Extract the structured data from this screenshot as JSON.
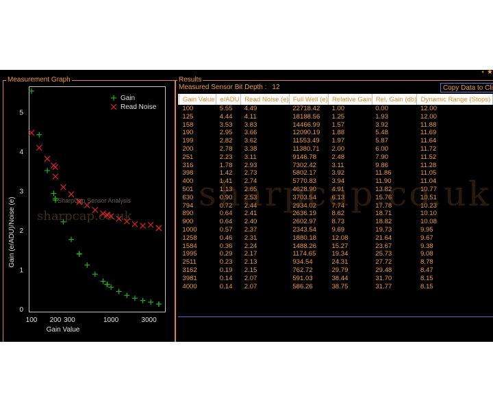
{
  "window": {
    "corner_glyphs": "⋆ ★"
  },
  "graph_panel": {
    "title": "Measurement Graph"
  },
  "results_panel": {
    "title": "Results",
    "bit_depth_label": "Measured Sensor Bit Depth :",
    "bit_depth_value": "12",
    "copy_button_label": "Copy Data to Clipboard"
  },
  "table": {
    "headers": [
      "Gain Value",
      "e/ADU",
      "Read Noise (e)",
      "Full Well (e)",
      "Relative Gain",
      "Rel. Gain (db)",
      "Dynamic Range (Stops)"
    ],
    "rows": [
      [
        "100",
        "5.55",
        "4.49",
        "22718.42",
        "1.00",
        "0.00",
        "12.00"
      ],
      [
        "125",
        "4.44",
        "4.11",
        "18188.56",
        "1.25",
        "1.93",
        "12.00"
      ],
      [
        "158",
        "3.53",
        "3.83",
        "14466.99",
        "1.57",
        "3.92",
        "11.88"
      ],
      [
        "190",
        "2.95",
        "3.66",
        "12090.19",
        "1.88",
        "5.48",
        "11.69"
      ],
      [
        "199",
        "2.82",
        "3.62",
        "11553.49",
        "1.97",
        "5.87",
        "11.64"
      ],
      [
        "200",
        "2.78",
        "3.38",
        "11380.71",
        "2.00",
        "6.00",
        "11.72"
      ],
      [
        "251",
        "2.23",
        "3.11",
        "9146.78",
        "2.48",
        "7.90",
        "11.52"
      ],
      [
        "316",
        "1.78",
        "2.93",
        "7302.42",
        "3.11",
        "9.86",
        "11.28"
      ],
      [
        "398",
        "1.42",
        "2.73",
        "5802.17",
        "3.92",
        "11.86",
        "11.05"
      ],
      [
        "400",
        "1.41",
        "2.74",
        "5770.83",
        "3.94",
        "11.90",
        "11.04"
      ],
      [
        "501",
        "1.13",
        "2.65",
        "4628.90",
        "4.91",
        "13.82",
        "10.77"
      ],
      [
        "630",
        "0.90",
        "2.53",
        "3703.54",
        "6.13",
        "15.76",
        "10.51"
      ],
      [
        "794",
        "0.72",
        "2.44",
        "2934.02",
        "7.74",
        "17.78",
        "10.23"
      ],
      [
        "890",
        "0.64",
        "2.41",
        "2636.19",
        "8.62",
        "18.71",
        "10.10"
      ],
      [
        "900",
        "0.64",
        "2.40",
        "2602.97",
        "8.73",
        "18.82",
        "10.08"
      ],
      [
        "1000",
        "0.57",
        "2.37",
        "2343.54",
        "9.69",
        "19.73",
        "9.95"
      ],
      [
        "1258",
        "0.46",
        "2.31",
        "1880.18",
        "12.08",
        "21.64",
        "9.67"
      ],
      [
        "1584",
        "0.36",
        "2.24",
        "1488.26",
        "15.27",
        "23.67",
        "9.38"
      ],
      [
        "1995",
        "0.29",
        "2.17",
        "1174.65",
        "19.34",
        "25.73",
        "9.08"
      ],
      [
        "2511",
        "0.23",
        "2.13",
        "934.54",
        "24.31",
        "27.72",
        "8.78"
      ],
      [
        "3162",
        "0.19",
        "2.15",
        "762.72",
        "29.79",
        "29.48",
        "8.47"
      ],
      [
        "3981",
        "0.14",
        "2.07",
        "591.03",
        "38.44",
        "31.70",
        "8.15"
      ],
      [
        "4000",
        "0.14",
        "2.07",
        "586.26",
        "38.75",
        "31.77",
        "8.15"
      ]
    ]
  },
  "watermark_text": "sharpcap.co.uk",
  "chart_data": {
    "type": "scatter",
    "xlabel": "Gain Value",
    "ylabel": "Gain (e/ADU)/Noise (e)",
    "xscale": "log",
    "xlim": [
      100,
      4500
    ],
    "ylim": [
      0,
      5.6
    ],
    "x_ticks": [
      100,
      200,
      300,
      1000,
      3000
    ],
    "x_tick_labels": [
      "100",
      "200",
      "300",
      "1000",
      "3000"
    ],
    "y_ticks": [
      0,
      1,
      2,
      3,
      4,
      5
    ],
    "y_tick_labels": [
      "0",
      "1",
      "2",
      "3",
      "4",
      "5"
    ],
    "overlay_text": "SharpCap Sensor Analysis",
    "legend_position": "top-right",
    "x": [
      100,
      125,
      158,
      190,
      199,
      200,
      251,
      316,
      398,
      400,
      501,
      630,
      794,
      890,
      900,
      1000,
      1258,
      1584,
      1995,
      2511,
      3162,
      3981,
      4000
    ],
    "series": [
      {
        "name": "Gain",
        "marker": "plus",
        "color": "#1fb01f",
        "values": [
          5.55,
          4.44,
          3.53,
          2.95,
          2.82,
          2.78,
          2.23,
          1.78,
          1.42,
          1.41,
          1.13,
          0.9,
          0.72,
          0.64,
          0.64,
          0.57,
          0.46,
          0.36,
          0.29,
          0.23,
          0.19,
          0.14,
          0.14
        ]
      },
      {
        "name": "Read Noise",
        "marker": "x",
        "color": "#e02020",
        "values": [
          4.49,
          4.11,
          3.83,
          3.66,
          3.62,
          3.38,
          3.11,
          2.93,
          2.73,
          2.74,
          2.65,
          2.53,
          2.44,
          2.41,
          2.4,
          2.37,
          2.31,
          2.24,
          2.17,
          2.13,
          2.15,
          2.07,
          2.07
        ]
      }
    ]
  }
}
